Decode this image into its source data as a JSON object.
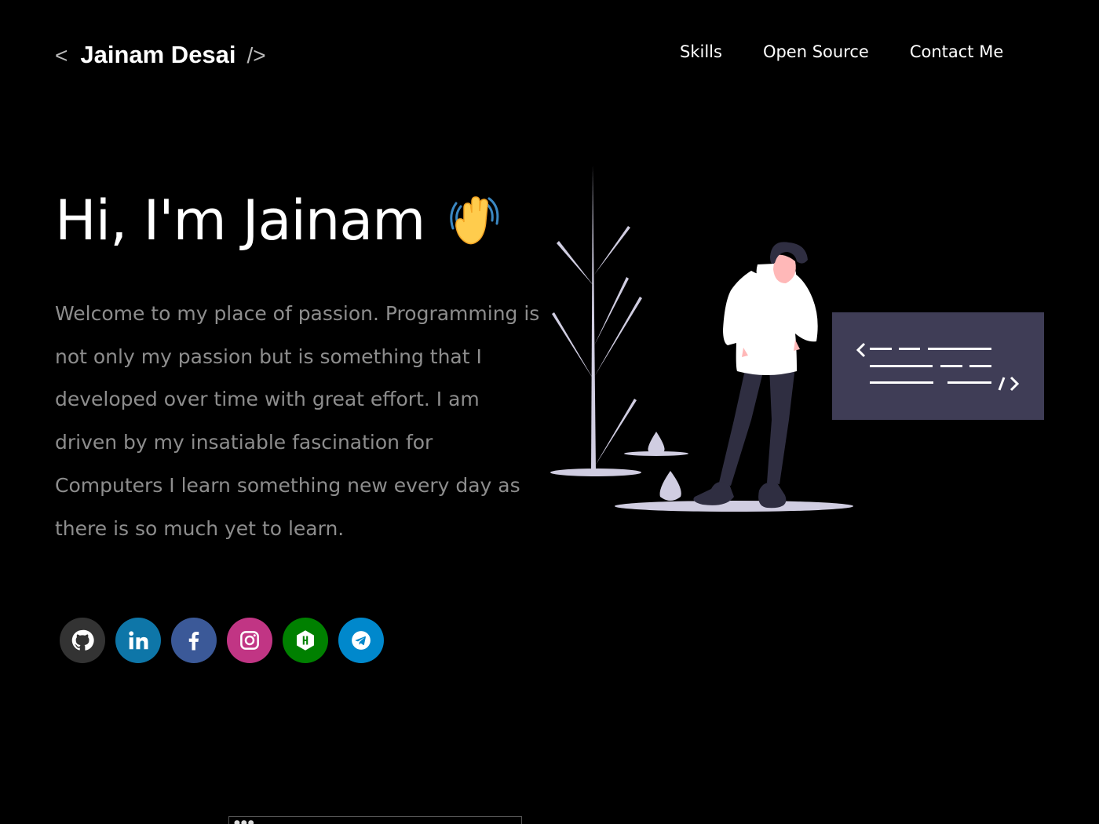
{
  "header": {
    "logo_open": "<",
    "logo_name": "Jainam Desai",
    "logo_close": "/>",
    "nav": [
      "Skills",
      "Open Source",
      "Contact Me"
    ]
  },
  "hero": {
    "greeting": "Hi, I'm Jainam",
    "intro": "Welcome to my place of passion. Programming is not only my passion but is something that I developed over time with great effort. I am driven by my insatiable fascination for Computers I learn something new every day as there is so much yet to learn."
  },
  "social": [
    {
      "name": "github-icon",
      "color": "#333333"
    },
    {
      "name": "linkedin-icon",
      "color": "#0e76a8"
    },
    {
      "name": "facebook-icon",
      "color": "#3b5998"
    },
    {
      "name": "instagram-icon",
      "color": "#c13584"
    },
    {
      "name": "hackerrank-icon",
      "color": "#008000"
    },
    {
      "name": "telegram-icon",
      "color": "#0088cc"
    }
  ],
  "colors": {
    "background": "#000000",
    "intro_text": "#8d8d8d",
    "code_panel": "#3f3d56",
    "plant": "#d0cde1"
  }
}
